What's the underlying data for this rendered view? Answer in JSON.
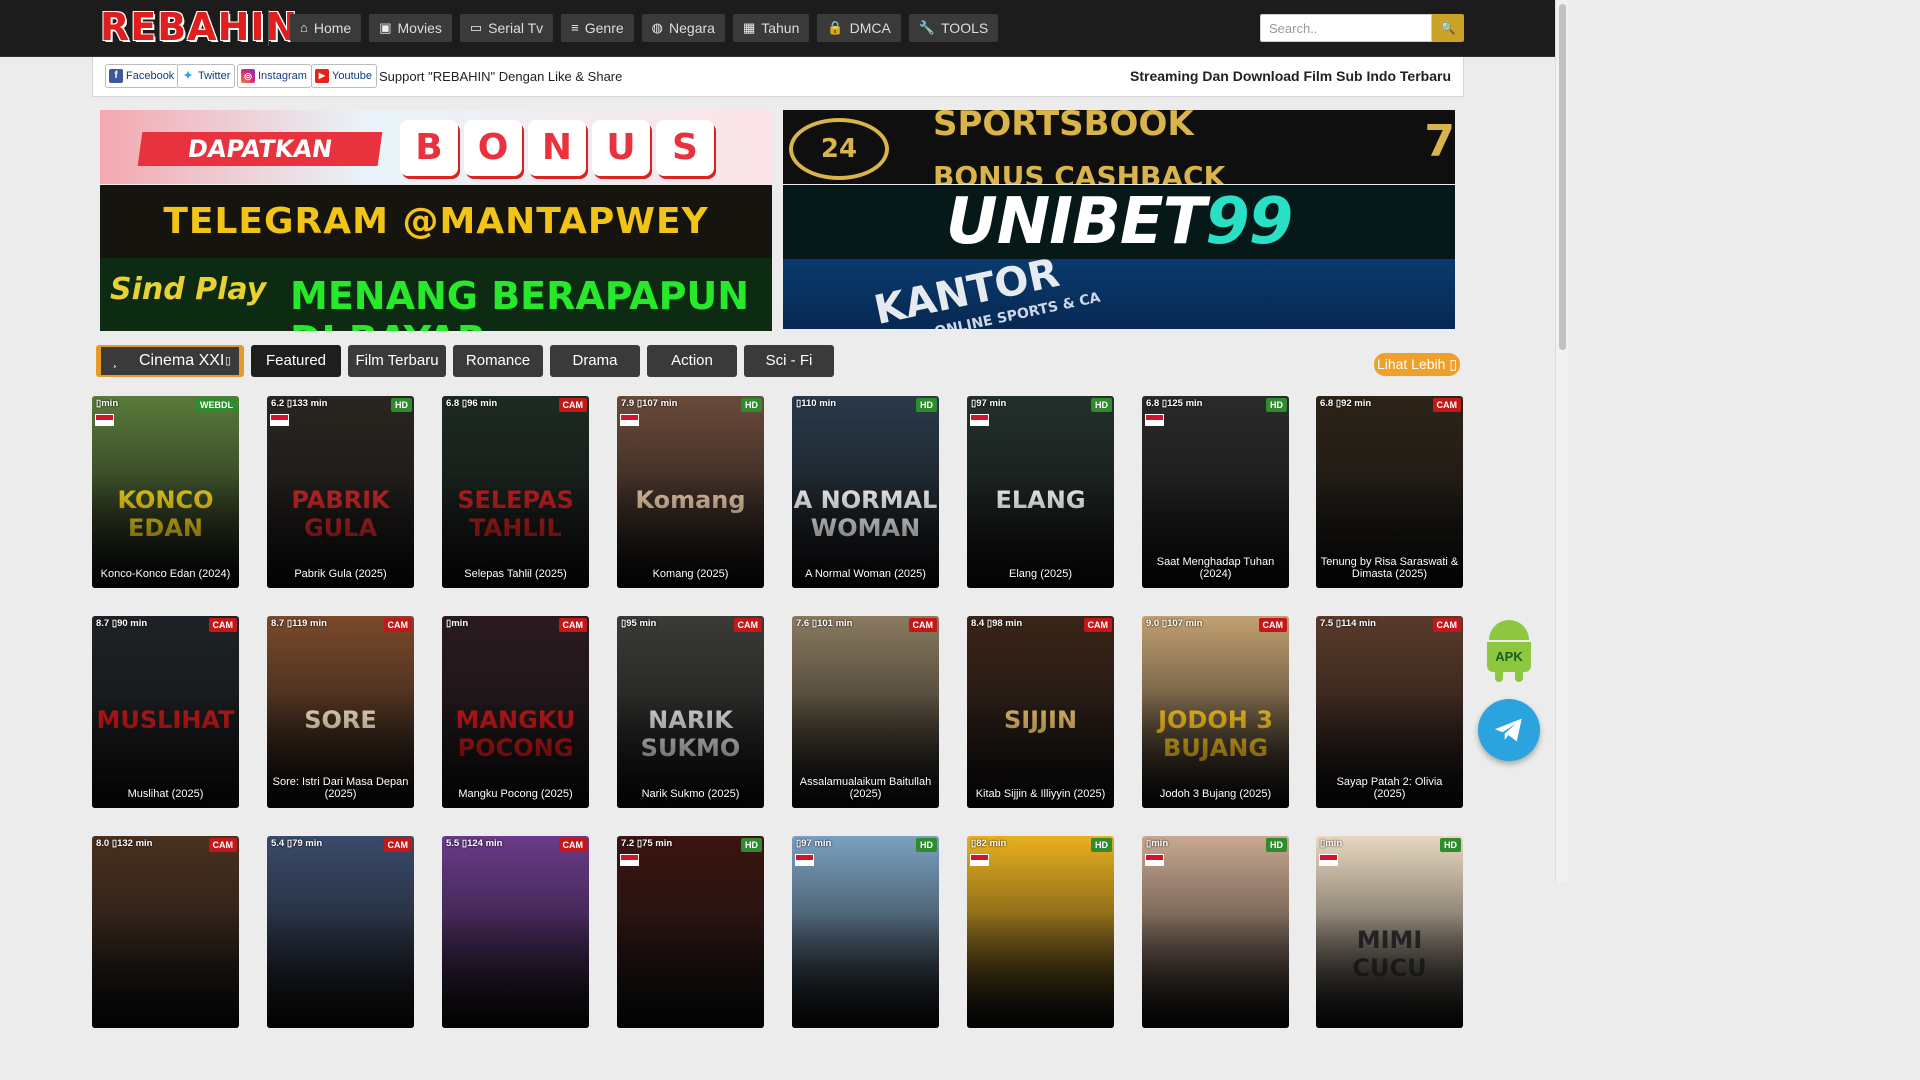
{
  "nav": {
    "logo": "REBAHIN",
    "menu": [
      {
        "label": "Home",
        "icon": "home-icon",
        "glyph": "⌂"
      },
      {
        "label": "Movies",
        "icon": "film-icon",
        "glyph": "▣"
      },
      {
        "label": "Serial Tv",
        "icon": "tv-icon",
        "glyph": "▭"
      },
      {
        "label": "Genre",
        "icon": "list-icon",
        "glyph": "≡"
      },
      {
        "label": "Negara",
        "icon": "globe-icon",
        "glyph": "◍"
      },
      {
        "label": "Tahun",
        "icon": "calendar-icon",
        "glyph": "▦"
      },
      {
        "label": "DMCA",
        "icon": "lock-icon",
        "glyph": "🔒"
      },
      {
        "label": "TOOLS",
        "icon": "wrench-icon",
        "glyph": "🔧"
      }
    ],
    "search_placeholder": "Search..",
    "search_icon_glyph": "🔍"
  },
  "social": {
    "facebook": "Facebook",
    "twitter": "Twitter",
    "instagram": "Instagram",
    "youtube": "Youtube",
    "support_text": "Support \"REBAHIN\" Dengan Like & Share",
    "tagline": "Streaming Dan Download Film Sub Indo Terbaru"
  },
  "banners": {
    "b1_tag": "DAPATKAN",
    "b1_letters": [
      "B",
      "O",
      "N",
      "U",
      "S"
    ],
    "b2": "TELEGRAM @MANTAPWEY",
    "b3_logo": "Sind Play",
    "b3_text": "MENANG BERAPAPUN DI BAYAR",
    "b4_seal": "24",
    "b4_text1": "SPORTSBOOK",
    "b4_text2": "BONUS CASHBACK",
    "b4_num": "7",
    "b5_a": "UNIBET",
    "b5_b": "99",
    "b6_text": "KANTOR",
    "b6_sub": "ONLINE SPORTS & CA"
  },
  "tabs": {
    "cinema": "Cinema XXI",
    "items": [
      "Featured",
      "Film Terbaru",
      "Romance",
      "Drama",
      "Action",
      "Sci - Fi"
    ],
    "active_index": 0,
    "more": "Lihat Lebih"
  },
  "movies": [
    {
      "title": "Konco-Konco Edan (2024)",
      "rating": "",
      "duration": "min",
      "quality": "WEBDL",
      "flag": true,
      "bg": "#5a7a3a",
      "accent": "#f5d41a",
      "poster": "KONCO EDAN"
    },
    {
      "title": "Pabrik Gula (2025)",
      "rating": "6.2",
      "duration": "133 min",
      "quality": "HD",
      "flag": true,
      "bg": "#2a2520",
      "accent": "#c82828",
      "poster": "PABRIK GULA"
    },
    {
      "title": "Selepas Tahlil (2025)",
      "rating": "6.8",
      "duration": "96 min",
      "quality": "CAM",
      "flag": false,
      "bg": "#1d2a22",
      "accent": "#c42020",
      "poster": "SELEPAS TAHLIL"
    },
    {
      "title": "Komang (2025)",
      "rating": "7.9",
      "duration": "107 min",
      "quality": "HD",
      "flag": true,
      "bg": "#6a4a3a",
      "accent": "#e8c9a8",
      "poster": "Komang"
    },
    {
      "title": "A Normal Woman (2025)",
      "rating": "",
      "duration": "110 min",
      "quality": "HD",
      "flag": false,
      "bg": "#2a3a4a",
      "accent": "#ffffff",
      "poster": "A NORMAL WOMAN"
    },
    {
      "title": "Elang (2025)",
      "rating": "",
      "duration": "97 min",
      "quality": "HD",
      "flag": true,
      "bg": "#23302a",
      "accent": "#ffffff",
      "poster": "ELANG"
    },
    {
      "title": "Saat Menghadap Tuhan (2024)",
      "rating": "6.8",
      "duration": "125 min",
      "quality": "HD",
      "flag": true,
      "bg": "#2a2a2a",
      "accent": "#cccccc",
      "poster": ""
    },
    {
      "title": "Tenung by Risa Saraswati & Dimasta (2025)",
      "rating": "6.8",
      "duration": "92 min",
      "quality": "CAM",
      "flag": false,
      "bg": "#2d2418",
      "accent": "#a08a5a",
      "poster": ""
    },
    {
      "title": "Muslihat (2025)",
      "rating": "8.7",
      "duration": "90 min",
      "quality": "CAM",
      "flag": false,
      "bg": "#1e2226",
      "accent": "#c41818",
      "poster": "MUSLIHAT"
    },
    {
      "title": "Sore: Istri Dari Masa Depan (2025)",
      "rating": "8.7",
      "duration": "119 min",
      "quality": "CAM",
      "flag": false,
      "bg": "#7a4a2a",
      "accent": "#f0e0c0",
      "poster": "SORE"
    },
    {
      "title": "Mangku Pocong (2025)",
      "rating": "",
      "duration": "min",
      "quality": "CAM",
      "flag": false,
      "bg": "#2a1a20",
      "accent": "#c41818",
      "poster": "MANGKU POCONG"
    },
    {
      "title": "Narik Sukmo (2025)",
      "rating": "",
      "duration": "95 min",
      "quality": "CAM",
      "flag": false,
      "bg": "#3a3a36",
      "accent": "#dddddd",
      "poster": "NARIK SUKMO"
    },
    {
      "title": "Assalamualaikum Baitullah (2025)",
      "rating": "7.6",
      "duration": "101 min",
      "quality": "CAM",
      "flag": false,
      "bg": "#8a7a60",
      "accent": "#ffffff",
      "poster": ""
    },
    {
      "title": "Kitab Sijjin & Illiyyin (2025)",
      "rating": "8.4",
      "duration": "98 min",
      "quality": "CAM",
      "flag": false,
      "bg": "#3a2418",
      "accent": "#e8c070",
      "poster": "SIJJIN"
    },
    {
      "title": "Jodoh 3 Bujang (2025)",
      "rating": "9.0",
      "duration": "107 min",
      "quality": "CAM",
      "flag": false,
      "bg": "#c2a070",
      "accent": "#f5c020",
      "poster": "JODOH 3 BUJANG"
    },
    {
      "title": "Sayap Patah 2: Olivia (2025)",
      "rating": "7.5",
      "duration": "114 min",
      "quality": "CAM",
      "flag": false,
      "bg": "#5a3a2a",
      "accent": "#e0c0a0",
      "poster": ""
    },
    {
      "title": "",
      "rating": "8.0",
      "duration": "132 min",
      "quality": "CAM",
      "flag": false,
      "bg": "#4a3020",
      "accent": "#f0c060",
      "poster": ""
    },
    {
      "title": "",
      "rating": "5.4",
      "duration": "79 min",
      "quality": "CAM",
      "flag": false,
      "bg": "#3a4a6a",
      "accent": "#40d0e0",
      "poster": ""
    },
    {
      "title": "",
      "rating": "5.5",
      "duration": "124 min",
      "quality": "CAM",
      "flag": false,
      "bg": "#6a3a8a",
      "accent": "#f5d020",
      "poster": ""
    },
    {
      "title": "",
      "rating": "7.2",
      "duration": "75 min",
      "quality": "HD",
      "flag": true,
      "bg": "#3a1410",
      "accent": "#e03020",
      "poster": ""
    },
    {
      "title": "",
      "rating": "",
      "duration": "97 min",
      "quality": "HD",
      "flag": true,
      "bg": "#7aa0c0",
      "accent": "#ffffff",
      "poster": ""
    },
    {
      "title": "",
      "rating": "",
      "duration": "82 min",
      "quality": "HD",
      "flag": true,
      "bg": "#e8b020",
      "accent": "#ffffff",
      "poster": ""
    },
    {
      "title": "",
      "rating": "",
      "duration": "min",
      "quality": "HD",
      "flag": true,
      "bg": "#c8a890",
      "accent": "#ffffff",
      "poster": ""
    },
    {
      "title": "",
      "rating": "",
      "duration": "min",
      "quality": "HD",
      "flag": true,
      "bg": "#e8d8c0",
      "accent": "#2a2a2a",
      "poster": "MIMI CUCU"
    }
  ],
  "floating": {
    "apk_label": "APK"
  }
}
